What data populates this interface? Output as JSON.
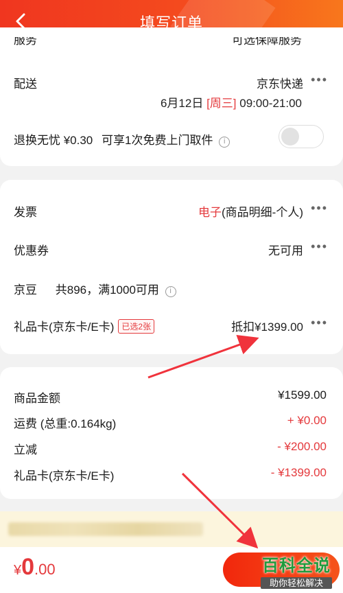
{
  "header": {
    "title": "填写订单",
    "back_icon": "chevron-left-icon"
  },
  "card1": {
    "cut_row": {
      "label": "服务",
      "value": "可选保障服务"
    },
    "delivery": {
      "label": "配送",
      "carrier": "京东快递",
      "date": "6月12日",
      "weekday": "[周三]",
      "time": "09:00-21:00"
    },
    "return": {
      "label": "退换无忧 ¥0.30",
      "desc": "可享1次免费上门取件",
      "toggle_on": false
    }
  },
  "card2": {
    "invoice": {
      "label": "发票",
      "type": "电子",
      "detail": "(商品明细-个人)"
    },
    "coupon": {
      "label": "优惠券",
      "value": "无可用"
    },
    "beans": {
      "label": "京豆",
      "value": "共896，满1000可用"
    },
    "giftcard": {
      "label": "礼品卡(京东卡/E卡)",
      "badge": "已选2张",
      "value": "抵扣¥1399.00"
    }
  },
  "card3": {
    "rows": [
      {
        "label": "商品金额",
        "value": "¥1599.00"
      },
      {
        "label": "运费 (总重:0.164kg)",
        "value": "+ ¥0.00"
      },
      {
        "label": "立减",
        "value": "- ¥200.00"
      },
      {
        "label": "礼品卡(京东卡/E卡)",
        "value": "- ¥1399.00"
      }
    ]
  },
  "bottom": {
    "currency": "¥",
    "price_int": "0",
    "price_dec": ".00"
  },
  "watermark": {
    "line1": "百科全说",
    "line2": "助你轻松解决"
  },
  "colors": {
    "brand_red": "#e4393c",
    "header_start": "#f0361f",
    "header_end": "#f8771c"
  }
}
